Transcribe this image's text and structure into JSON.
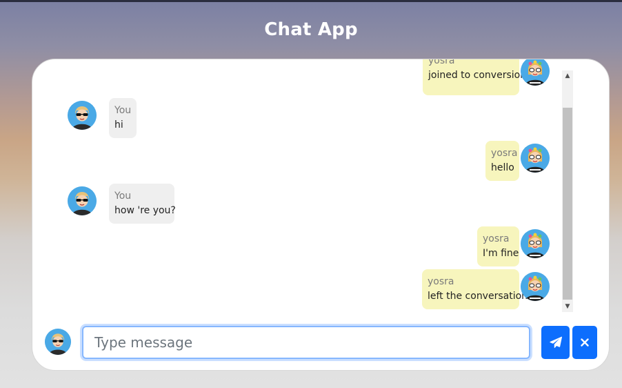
{
  "app": {
    "title": "Chat App"
  },
  "messages": [
    {
      "side": "right",
      "sender": "yosra",
      "text": "joined to conversion"
    },
    {
      "side": "left",
      "sender": "You",
      "text": "hi"
    },
    {
      "side": "right",
      "sender": "yosra",
      "text": "hello"
    },
    {
      "side": "left",
      "sender": "You",
      "text": "how 're you?"
    },
    {
      "side": "right",
      "sender": "yosra",
      "text": "I'm fine"
    },
    {
      "side": "right",
      "sender": "yosra",
      "text": "left the conversation"
    }
  ],
  "composer": {
    "placeholder": "Type message",
    "value": ""
  },
  "icons": {
    "send": "paper-plane-icon",
    "close": "close-icon"
  },
  "colors": {
    "accent": "#0d6efd",
    "my_bubble": "#efefef",
    "other_bubble": "#f7f5bd",
    "avatar_bg": "#4aa9e6"
  }
}
